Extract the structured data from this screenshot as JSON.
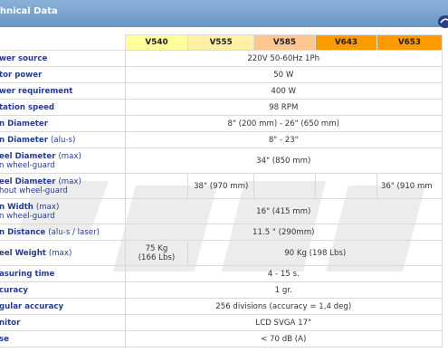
{
  "header": {
    "title": "chnical Data"
  },
  "models": [
    "V540",
    "V555",
    "V585",
    "V643",
    "V653"
  ],
  "model_colors": [
    "#ffff99",
    "#fff0a6",
    "#ffc78f",
    "#ff9900",
    "#ff9a00"
  ],
  "rows": {
    "power_source": {
      "label": "wer source",
      "value": "220V 50-60Hz 1Ph"
    },
    "motor_power": {
      "label": "tor power",
      "value": "50 W"
    },
    "power_requirement": {
      "label": "wer requirement",
      "value": "400 W"
    },
    "rotation_speed": {
      "label": "tation speed",
      "value": "98 RPM"
    },
    "rim_diameter": {
      "label": "n Diameter",
      "value": "8\" (200 mm) - 26\" (650 mm)"
    },
    "rim_diameter_alus": {
      "label": "n Diameter",
      "paren": "(alu-s)",
      "value": "8\" - 23\""
    },
    "wheel_diameter_max": {
      "label": "eel Diameter",
      "paren": "(max)",
      "sub": "n wheel-guard",
      "value": "34\" (850 mm)"
    },
    "wheel_diameter_noguard": {
      "label": "eel Diameter",
      "paren": "(max)",
      "sub": "hout wheel-guard",
      "value_v555": "38\" (970 mm)",
      "value_v653": "36\" (910 mm"
    },
    "rim_width": {
      "label": "n Width",
      "paren": "(max)",
      "sub": "n wheel-guard",
      "value": "16\" (415 mm)"
    },
    "rim_distance": {
      "label": "n Distance",
      "paren": "(alu-s / laser)",
      "value": "11.5 \" (290mm)"
    },
    "wheel_weight": {
      "label": "eel Weight",
      "paren": "(max)",
      "value_v540": "75 Kg",
      "value_v540_b": "(166 Lbs)",
      "value_rest": "90 Kg (198 Lbs)"
    },
    "measuring_time": {
      "label": "asuring time",
      "value": "4 - 15 s."
    },
    "accuracy": {
      "label": "curacy",
      "value": "1 gr."
    },
    "angular_accuracy": {
      "label": "gular accuracy",
      "value": "256 divisions (accuracy = 1,4 deg)"
    },
    "monitor": {
      "label": "nitor",
      "value": "LCD SVGA 17\""
    },
    "noise": {
      "label": "se",
      "value": "< 70 dB (A)"
    }
  },
  "icons": {
    "logo": "brand-logo-icon",
    "watermark": "sicam-watermark"
  }
}
